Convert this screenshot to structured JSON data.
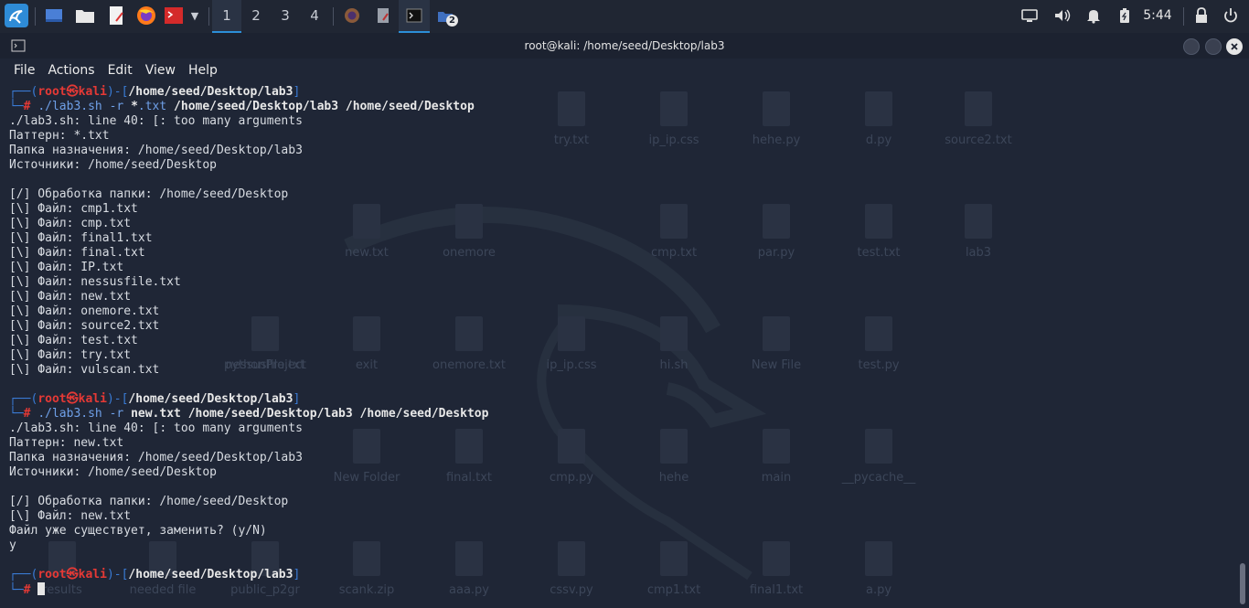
{
  "taskbar": {
    "workspaces": [
      "1",
      "2",
      "3",
      "4"
    ],
    "active_workspace": "1",
    "files_badge": "2",
    "clock": "5:44"
  },
  "window": {
    "title": "root@kali: /home/seed/Desktop/lab3"
  },
  "menu": [
    "File",
    "Actions",
    "Edit",
    "View",
    "Help"
  ],
  "prompt": {
    "user": "root",
    "symbol": "㉿",
    "host": "kali",
    "path": "/home/seed/Desktop/lab3"
  },
  "commands": [
    {
      "cmd": "./lab3.sh",
      "flag": "-r",
      "glob": "*",
      "glob_rest": ".txt",
      "dest": "/home/seed/Desktop/lab3",
      "src": "/home/seed/Desktop",
      "output": [
        "./lab3.sh: line 40: [: too many arguments",
        "Паттерн: *.txt",
        "Папка назначения: /home/seed/Desktop/lab3",
        "Источники: /home/seed/Desktop",
        "",
        "[/] Обработка папки: /home/seed/Desktop",
        "[\\] Файл: cmp1.txt",
        "[\\] Файл: cmp.txt",
        "[\\] Файл: final1.txt",
        "[\\] Файл: final.txt",
        "[\\] Файл: IP.txt",
        "[\\] Файл: nessusfile.txt",
        "[\\] Файл: new.txt",
        "[\\] Файл: onemore.txt",
        "[\\] Файл: source2.txt",
        "[\\] Файл: test.txt",
        "[\\] Файл: try.txt",
        "[\\] Файл: vulscan.txt",
        ""
      ]
    },
    {
      "cmd": "./lab3.sh",
      "flag": "-r",
      "pattern": "new.txt",
      "dest": "/home/seed/Desktop/lab3",
      "src": "/home/seed/Desktop",
      "output": [
        "./lab3.sh: line 40: [: too many arguments",
        "Паттерн: new.txt",
        "Папка назначения: /home/seed/Desktop/lab3",
        "Источники: /home/seed/Desktop",
        "",
        "[/] Обработка папки: /home/seed/Desktop",
        "[\\] Файл: new.txt",
        "Файл уже существует, заменить? (y/N)",
        "y",
        ""
      ]
    }
  ],
  "desktop_ghost": [
    "try.txt",
    "ip_ip.css",
    "hehe.py",
    "d.py",
    "source2.txt",
    "new.txt",
    "onemore",
    "cmp.txt",
    "par.py",
    "test.txt",
    "lab3",
    "pythonProject",
    "nessusfile.txt",
    "exit",
    "onemore.txt",
    "ip_ip.css",
    "hi.sh",
    "New File",
    "test.py",
    "New Folder",
    "final.txt",
    "cmp.py",
    "hehe",
    "main",
    "__pycache__",
    "results",
    "needed file",
    "public_p2gr",
    "scank.zip",
    "aaa.py",
    "cssv.py",
    "cmp1.txt",
    "final1.txt",
    "a.py"
  ],
  "colors": {
    "prompt_bracket": "#3a7bd5",
    "prompt_root": "#e53935",
    "background": "#1f2636"
  }
}
